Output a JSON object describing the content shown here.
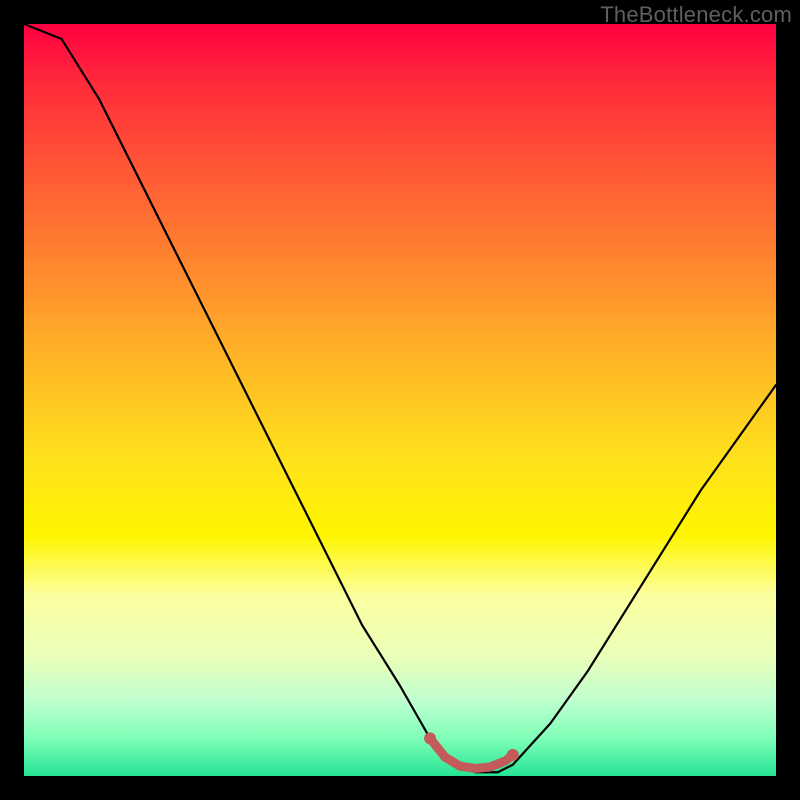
{
  "watermark": "TheBottleneck.com",
  "chart_data": {
    "type": "line",
    "title": "",
    "xlabel": "",
    "ylabel": "",
    "xlim": [
      0,
      100
    ],
    "ylim": [
      0,
      100
    ],
    "series": [
      {
        "name": "bottleneck-curve",
        "x": [
          0,
          5,
          10,
          15,
          20,
          25,
          30,
          35,
          40,
          45,
          50,
          54,
          57,
          60,
          63,
          65,
          70,
          75,
          80,
          85,
          90,
          95,
          100
        ],
        "y": [
          100,
          98,
          90,
          80,
          70,
          60,
          50,
          40,
          30,
          20,
          12,
          5,
          1.5,
          0.5,
          0.5,
          1.5,
          7,
          14,
          22,
          30,
          38,
          45,
          52
        ]
      },
      {
        "name": "trough-highlight",
        "x": [
          54,
          56,
          58,
          60,
          62,
          64,
          65
        ],
        "y": [
          5,
          2.5,
          1.3,
          1.0,
          1.2,
          2.0,
          2.8
        ]
      }
    ],
    "gradient_stops": [
      {
        "pos": 0,
        "color": "#ff0040"
      },
      {
        "pos": 8,
        "color": "#ff2b3a"
      },
      {
        "pos": 20,
        "color": "#ff5a35"
      },
      {
        "pos": 33,
        "color": "#ff8a2e"
      },
      {
        "pos": 45,
        "color": "#ffb726"
      },
      {
        "pos": 58,
        "color": "#ffe21c"
      },
      {
        "pos": 68,
        "color": "#fff500"
      },
      {
        "pos": 76,
        "color": "#fcffa0"
      },
      {
        "pos": 84,
        "color": "#eaffb8"
      },
      {
        "pos": 90,
        "color": "#bfffcf"
      },
      {
        "pos": 95,
        "color": "#7effb8"
      },
      {
        "pos": 100,
        "color": "#25e394"
      }
    ],
    "colors": {
      "curve": "#000000",
      "trough": "#c25b5a",
      "background_frame": "#000000"
    }
  }
}
